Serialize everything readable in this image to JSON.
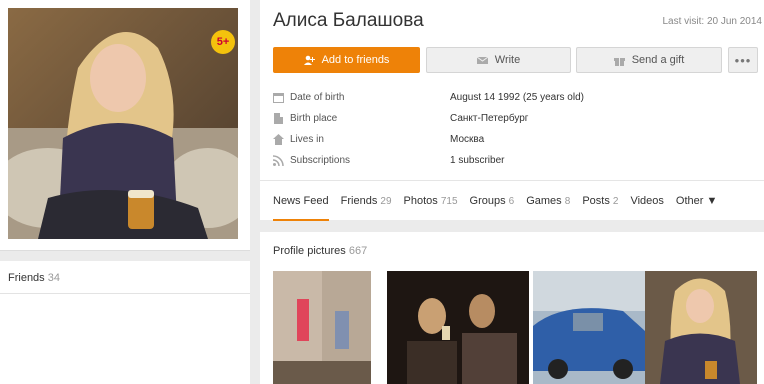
{
  "profile": {
    "name": "Алиса Балашова",
    "last_visit": "Last visit: 20 Jun 2014",
    "age_badge": "5+"
  },
  "actions": {
    "add_friend": "Add to friends",
    "write": "Write",
    "gift": "Send a gift",
    "more": "•••"
  },
  "info": {
    "dob_label": "Date of birth",
    "dob_value": "August 14 1992 (25 years old)",
    "birth_label": "Birth place",
    "birth_value": "Санкт-Петербург",
    "lives_label": "Lives in",
    "lives_value": "Москва",
    "subs_label": "Subscriptions",
    "subs_value": "1 subscriber"
  },
  "tabs": {
    "feed": "News Feed",
    "friends": "Friends",
    "friends_count": "29",
    "photos": "Photos",
    "photos_count": "715",
    "groups": "Groups",
    "groups_count": "6",
    "games": "Games",
    "games_count": "8",
    "posts": "Posts",
    "posts_count": "2",
    "videos": "Videos",
    "other": "Other ▼"
  },
  "friends_box": {
    "label": "Friends",
    "count": "34"
  },
  "photos_box": {
    "label": "Profile pictures",
    "count": "667"
  },
  "colors": {
    "accent": "#ee8208",
    "badge": "#f4c20d"
  },
  "icons": [
    "add-user-icon",
    "mail-icon",
    "gift-icon",
    "calendar-icon",
    "building-icon",
    "house-icon",
    "rss-icon"
  ]
}
